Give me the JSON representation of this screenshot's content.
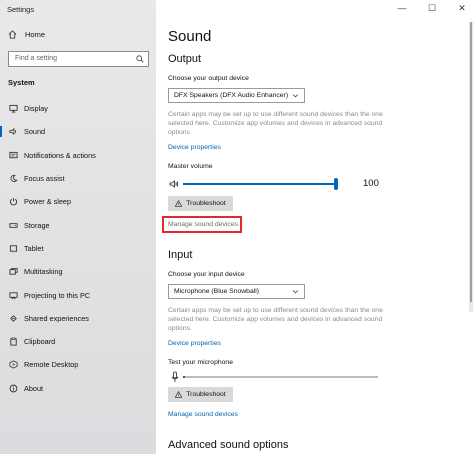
{
  "window": {
    "title": "Settings",
    "controls": {
      "minimize": "—",
      "maximize": "☐",
      "close": "✕"
    }
  },
  "sidebar": {
    "home_label": "Home",
    "search_placeholder": "Find a setting",
    "section_label": "System",
    "items": [
      {
        "label": "Display",
        "icon": "display-icon"
      },
      {
        "label": "Sound",
        "icon": "speaker-icon",
        "active": true
      },
      {
        "label": "Notifications & actions",
        "icon": "notifications-icon"
      },
      {
        "label": "Focus assist",
        "icon": "moon-icon"
      },
      {
        "label": "Power & sleep",
        "icon": "power-icon"
      },
      {
        "label": "Storage",
        "icon": "storage-icon"
      },
      {
        "label": "Tablet",
        "icon": "tablet-icon"
      },
      {
        "label": "Multitasking",
        "icon": "multitasking-icon"
      },
      {
        "label": "Projecting to this PC",
        "icon": "projecting-icon"
      },
      {
        "label": "Shared experiences",
        "icon": "shared-icon"
      },
      {
        "label": "Clipboard",
        "icon": "clipboard-icon"
      },
      {
        "label": "Remote Desktop",
        "icon": "remote-icon"
      },
      {
        "label": "About",
        "icon": "info-icon"
      }
    ]
  },
  "main": {
    "title": "Sound",
    "output": {
      "heading": "Output",
      "choose_label": "Choose your output device",
      "device": "DFX Speakers (DFX Audio Enhancer)",
      "description": "Certain apps may be set up to use different sound devices than the one selected here. Customize app volumes and devices in advanced sound options.",
      "device_properties": "Device properties",
      "master_volume_label": "Master volume",
      "master_volume_value": "100",
      "troubleshoot": "Troubleshoot",
      "manage_devices": "Manage sound devices"
    },
    "input": {
      "heading": "Input",
      "choose_label": "Choose your input device",
      "device": "Microphone (Blue Snowball)",
      "description": "Certain apps may be set up to use different sound devices than the one selected here. Customize app volumes and devices in advanced sound options.",
      "device_properties": "Device properties",
      "test_label": "Test your microphone",
      "troubleshoot": "Troubleshoot",
      "manage_devices": "Manage sound devices"
    },
    "advanced_heading": "Advanced sound options"
  },
  "colors": {
    "accent": "#0067c0",
    "link": "#0063b1",
    "highlight": "#e0282e",
    "sidebar_bg": "#e6e6e8"
  }
}
